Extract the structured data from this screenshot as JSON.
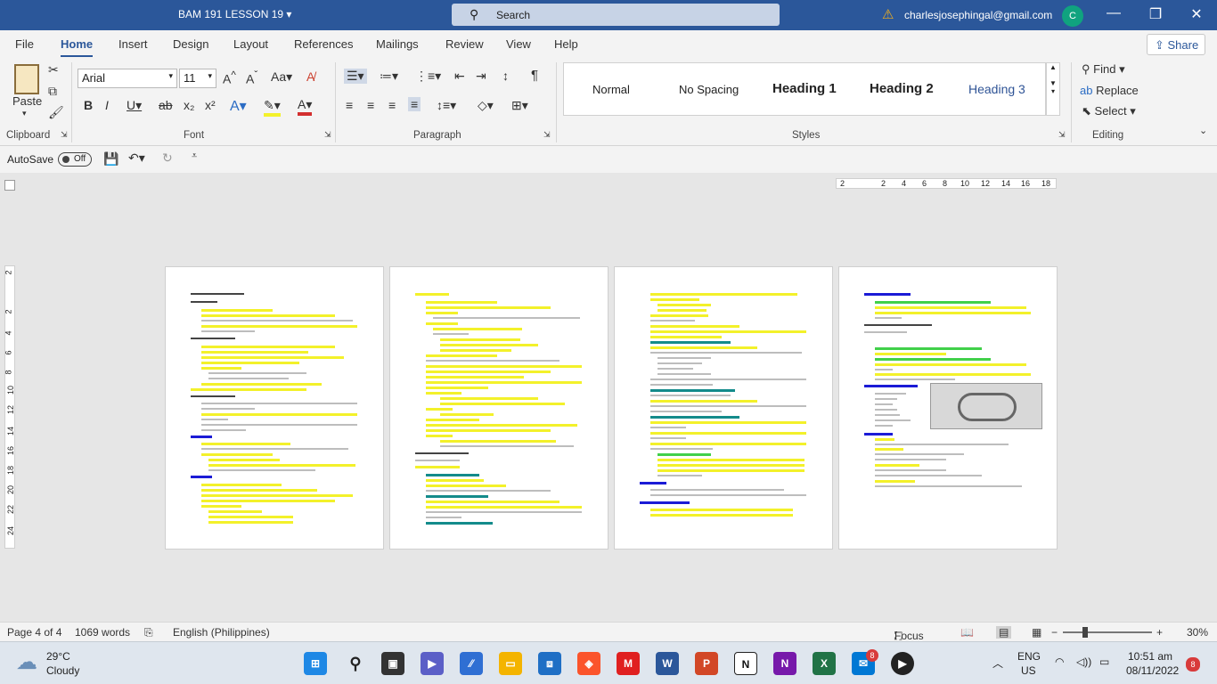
{
  "titlebar": {
    "doc_title": "BAM 191 LESSON 19",
    "search_placeholder": "Search",
    "email": "charlesjosephingal@gmail.com",
    "avatar_initial": "C",
    "minimize": "—",
    "restore": "❐",
    "close": "✕"
  },
  "tabs": [
    "File",
    "Home",
    "Insert",
    "Design",
    "Layout",
    "References",
    "Mailings",
    "Review",
    "View",
    "Help"
  ],
  "share_label": "Share",
  "ribbon": {
    "paste_label": "Paste",
    "font_name": "Arial",
    "font_size": "11",
    "styles": [
      "Normal",
      "No Spacing",
      "Heading 1",
      "Heading 2",
      "Heading 3"
    ],
    "editing": {
      "find": "Find",
      "replace": "Replace",
      "select": "Select"
    },
    "groups": {
      "clipboard": "Clipboard",
      "font": "Font",
      "paragraph": "Paragraph",
      "styles": "Styles",
      "editing": "Editing"
    }
  },
  "qat": {
    "autosave_label": "AutoSave",
    "autosave_state": "Off"
  },
  "ruler": {
    "h_ticks": [
      "2",
      "2",
      "4",
      "6",
      "8",
      "10",
      "12",
      "14",
      "16",
      "18"
    ],
    "v_ticks": [
      "2",
      "2",
      "4",
      "6",
      "8",
      "10",
      "12",
      "14",
      "16",
      "18",
      "20",
      "22",
      "24"
    ]
  },
  "status": {
    "page": "Page 4 of 4",
    "words": "1069 words",
    "language": "English (Philippines)",
    "focus": "Focus",
    "zoom": "30%"
  },
  "taskbar": {
    "weather_temp": "29°C",
    "weather_desc": "Cloudy",
    "lang1": "ENG",
    "lang2": "US",
    "time": "10:51 am",
    "date": "08/11/2022",
    "notif_count": "8",
    "app_badge": "8"
  }
}
